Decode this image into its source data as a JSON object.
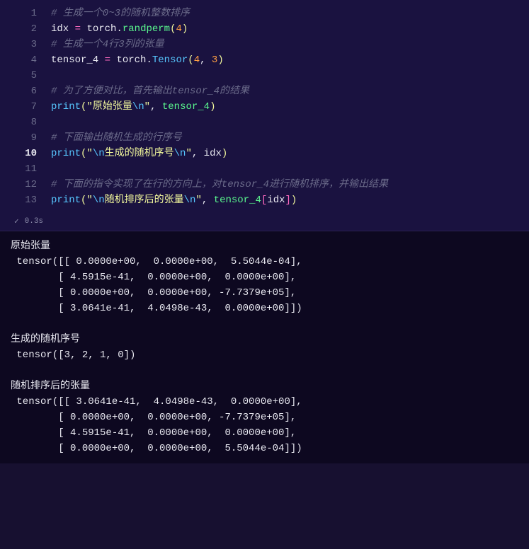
{
  "code": {
    "lines": [
      {
        "n": "1",
        "active": false
      },
      {
        "n": "2",
        "active": false
      },
      {
        "n": "3",
        "active": false
      },
      {
        "n": "4",
        "active": false
      },
      {
        "n": "5",
        "active": false
      },
      {
        "n": "6",
        "active": false
      },
      {
        "n": "7",
        "active": false
      },
      {
        "n": "8",
        "active": false
      },
      {
        "n": "9",
        "active": false
      },
      {
        "n": "10",
        "active": true
      },
      {
        "n": "11",
        "active": false
      },
      {
        "n": "12",
        "active": false
      },
      {
        "n": "13",
        "active": false
      }
    ],
    "l1_comment": "# 生成一个0~3的随机整数排序",
    "l2_idx": "idx",
    "l2_eq": " = ",
    "l2_torch": "torch",
    "l2_dot": ".",
    "l2_fn": "randperm",
    "l2_open": "(",
    "l2_num": "4",
    "l2_close": ")",
    "l3_comment": "# 生成一个4行3列的张量",
    "l4_var": "tensor_4",
    "l4_eq": " = ",
    "l4_torch": "torch",
    "l4_dot": ".",
    "l4_cls": "Tensor",
    "l4_open": "(",
    "l4_n1": "4",
    "l4_comma": ", ",
    "l4_n2": "3",
    "l4_close": ")",
    "l6_comment": "# 为了方便对比，首先输出tensor_4的结果",
    "l7_print": "print",
    "l7_open": "(",
    "l7_q1": "\"",
    "l7_str": "原始张量",
    "l7_esc": "\\n",
    "l7_q2": "\"",
    "l7_comma": ", ",
    "l7_arg": "tensor_4",
    "l7_close": ")",
    "l9_comment": "# 下面输出随机生成的行序号",
    "l10_print": "print",
    "l10_open": "(",
    "l10_q1": "\"",
    "l10_esc1": "\\n",
    "l10_str": "生成的随机序号",
    "l10_esc2": "\\n",
    "l10_q2": "\"",
    "l10_comma": ", ",
    "l10_arg": "idx",
    "l10_close": ")",
    "l12_comment": "# 下面的指令实现了在行的方向上，对tensor_4进行随机排序，并输出结果",
    "l13_print": "print",
    "l13_open": "(",
    "l13_q1": "\"",
    "l13_esc1": "\\n",
    "l13_str": "随机排序后的张量",
    "l13_esc2": "\\n",
    "l13_q2": "\"",
    "l13_comma": ", ",
    "l13_arg": "tensor_4",
    "l13_bopen": "[",
    "l13_idx": "idx",
    "l13_bclose": "]",
    "l13_close": ")"
  },
  "status": {
    "check": "✓",
    "time": "0.3s"
  },
  "output": "原始张量\n tensor([[ 0.0000e+00,  0.0000e+00,  5.5044e-04],\n        [ 4.5915e-41,  0.0000e+00,  0.0000e+00],\n        [ 0.0000e+00,  0.0000e+00, -7.7379e+05],\n        [ 3.0641e-41,  4.0498e-43,  0.0000e+00]])\n\n生成的随机序号\n tensor([3, 2, 1, 0])\n\n随机排序后的张量\n tensor([[ 3.0641e-41,  4.0498e-43,  0.0000e+00],\n        [ 0.0000e+00,  0.0000e+00, -7.7379e+05],\n        [ 4.5915e-41,  0.0000e+00,  0.0000e+00],\n        [ 0.0000e+00,  0.0000e+00,  5.5044e-04]])"
}
